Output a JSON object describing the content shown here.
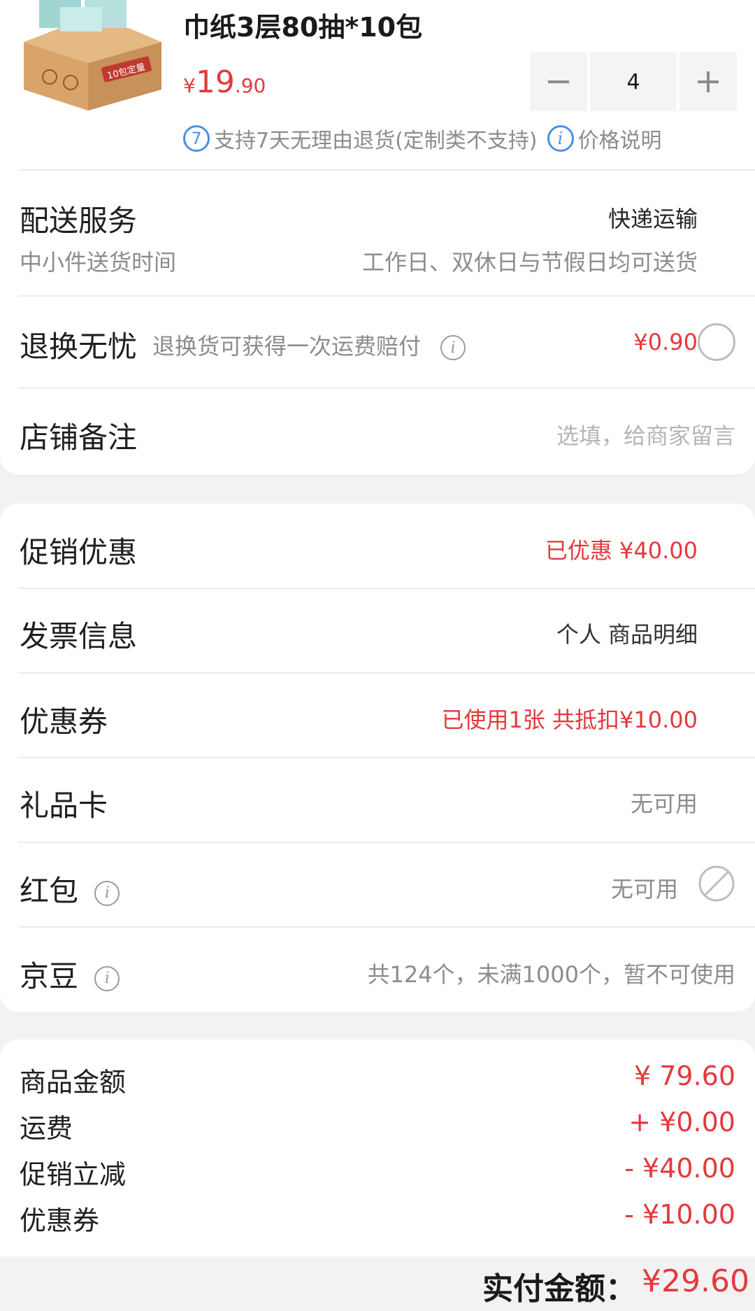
{
  "product": {
    "title": "巾纸3层80抽*10包",
    "price_currency": "¥",
    "price_int": "19",
    "price_dec": ".90",
    "quantity": "4",
    "box_label": "10包定量",
    "service_badge": "7",
    "service_text": "支持7天无理由退货(定制类不支持)",
    "price_note": "价格说明"
  },
  "delivery": {
    "title": "配送服务",
    "method": "快递运输",
    "time_label": "中小件送货时间",
    "time_value": "工作日、双休日与节假日均可送货"
  },
  "return_insurance": {
    "title": "退换无忧",
    "desc": "退换货可获得一次运费赔付",
    "price": "¥0.90"
  },
  "shop_note": {
    "title": "店铺备注",
    "placeholder": "选填，给商家留言"
  },
  "promotion": {
    "title": "促销优惠",
    "value": "已优惠 ¥40.00"
  },
  "invoice": {
    "title": "发票信息",
    "value": "个人 商品明细"
  },
  "coupon": {
    "title": "优惠券",
    "value": "已使用1张 共抵扣¥10.00"
  },
  "gift_card": {
    "title": "礼品卡",
    "value": "无可用"
  },
  "red_packet": {
    "title": "红包",
    "value": "无可用"
  },
  "jingdou": {
    "title": "京豆",
    "value": "共124个，未满1000个，暂不可使用"
  },
  "summary": {
    "items": [
      {
        "label": "商品金额",
        "value": "¥ 79.60"
      },
      {
        "label": "运费",
        "value": "+ ¥0.00"
      },
      {
        "label": "促销立减",
        "value": "- ¥40.00"
      },
      {
        "label": "优惠券",
        "value": "- ¥10.00"
      }
    ],
    "total_label": "实付金额：",
    "total_value": "¥29.60"
  },
  "colors": {
    "accent_red": "#e4393c",
    "info_blue": "#4a90e2"
  },
  "icons": [
    "product-box-image",
    "minus-icon",
    "plus-icon",
    "seven-day-return-icon",
    "info-icon",
    "radio-circle-icon",
    "disabled-icon"
  ]
}
